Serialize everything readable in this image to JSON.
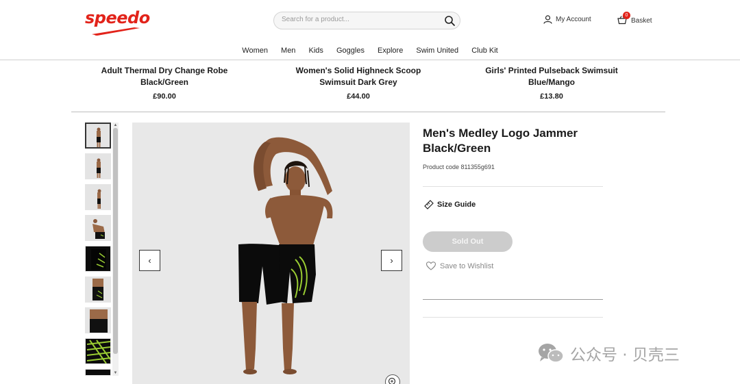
{
  "header": {
    "logo": "speedo",
    "search": {
      "placeholder": "Search for a product...",
      "value": ""
    },
    "account_label": "My Account",
    "basket_label": "Basket",
    "basket_count": "0"
  },
  "nav": {
    "items": [
      "Women",
      "Men",
      "Kids",
      "Goggles",
      "Explore",
      "Swim United",
      "Club Kit"
    ]
  },
  "related_products": [
    {
      "name_line1": "Adult Thermal Dry Change Robe",
      "name_line2": "Black/Green",
      "price": "£90.00"
    },
    {
      "name_line1": "Women's Solid Highneck Scoop",
      "name_line2": "Swimsuit Dark Grey",
      "price": "£44.00"
    },
    {
      "name_line1": "Girls' Printed Pulseback Swimsuit",
      "name_line2": "Blue/Mango",
      "price": "£13.80"
    }
  ],
  "product": {
    "title_line1": "Men's Medley Logo Jammer",
    "title_line2": "Black/Green",
    "code": "Product code 811355g691",
    "size_guide": "Size Guide",
    "sold_out": "Sold Out",
    "wishlist": "Save to Wishlist"
  },
  "gallery": {
    "prev_icon": "‹",
    "next_icon": "›"
  },
  "watermark": {
    "text": "公众号 · 贝壳三"
  },
  "colors": {
    "brand": "#e2231a",
    "sold_out_bg": "#cccccc",
    "jammer_accent": "#9acd32"
  }
}
